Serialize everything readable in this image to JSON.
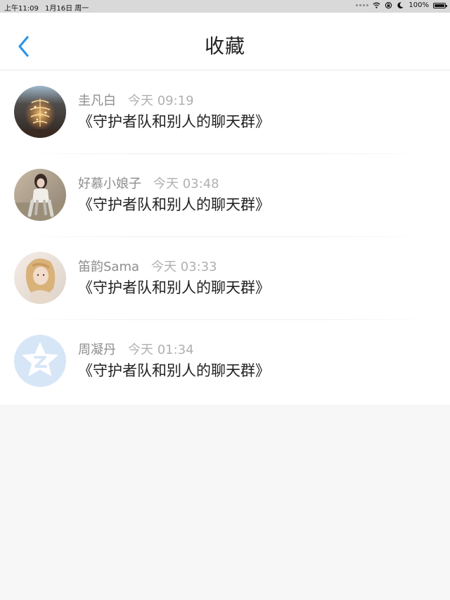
{
  "status_bar": {
    "time": "上午11:09",
    "date": "1月16日 周一",
    "battery_percent": "100%"
  },
  "header": {
    "title": "收藏",
    "back_icon": "chevron-left-icon"
  },
  "favorites": [
    {
      "sender": "圭凡白",
      "time": "今天 09:19",
      "message": "《守护者队和别人的聊天群》",
      "avatar": "sparkler-photo"
    },
    {
      "sender": "好慕小娘子",
      "time": "今天 03:48",
      "message": "《守护者队和别人的聊天群》",
      "avatar": "girl-photo"
    },
    {
      "sender": "笛韵Sama",
      "time": "今天 03:33",
      "message": "《守护者队和别人的聊天群》",
      "avatar": "blonde-girl-photo"
    },
    {
      "sender": "周凝丹",
      "time": "今天 01:34",
      "message": "《守护者队和别人的聊天群》",
      "avatar": "default-star-avatar"
    }
  ],
  "colors": {
    "accent": "#2b95e9",
    "background": "#f8f7f7",
    "secondary_text": "#8e8e8e",
    "default_avatar": "#d6e6f7"
  }
}
